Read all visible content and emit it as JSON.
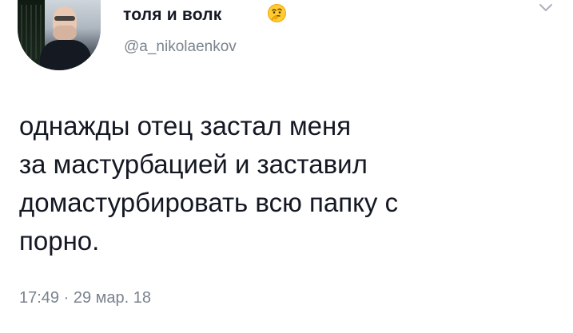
{
  "user": {
    "display_name": "толя и волк",
    "handle": "@a_nikolaenkov",
    "badge_icon": "thinking-face-icon"
  },
  "tweet": {
    "text": "однажды отец застал меня\nза мастурбацией и заставил\nдомастурбировать всю папку с\nпорно.",
    "time": "17:49",
    "separator": " · ",
    "date": "29 мар. 18"
  },
  "ui": {
    "menu_icon": "chevron-down-icon",
    "colors": {
      "text": "#141823",
      "secondary": "#7a838d",
      "background": "#ffffff"
    }
  }
}
